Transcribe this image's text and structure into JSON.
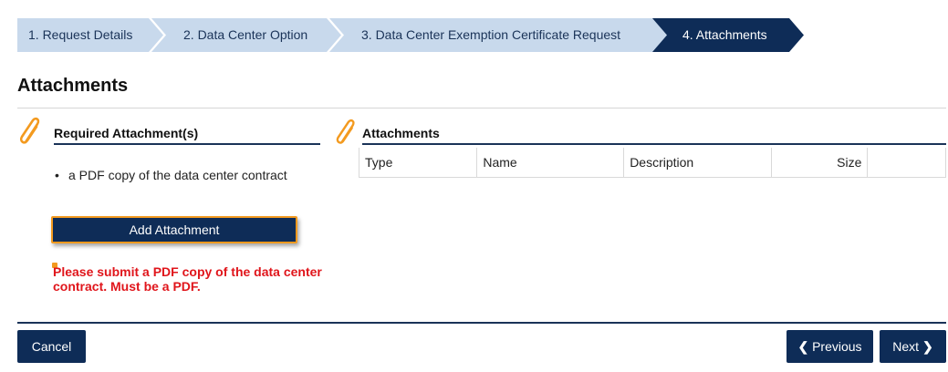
{
  "wizard": {
    "steps": [
      {
        "label": "1. Request Details",
        "active": false
      },
      {
        "label": "2. Data Center Option",
        "active": false
      },
      {
        "label": "3. Data Center Exemption Certificate Request",
        "active": false
      },
      {
        "label": "4. Attachments",
        "active": true
      }
    ],
    "colors": {
      "inactive": "#c8d9ec",
      "active": "#0e2c57"
    }
  },
  "page": {
    "title": "Attachments"
  },
  "required": {
    "heading": "Required Attachment(s)",
    "items": [
      "a PDF copy of the data center contract"
    ],
    "add_button": "Add Attachment",
    "error": "Please submit a PDF copy of the data center contract. Must be a PDF."
  },
  "attachments": {
    "heading": "Attachments",
    "columns": {
      "type": "Type",
      "name": "Name",
      "description": "Description",
      "size": "Size"
    }
  },
  "footer": {
    "cancel": "Cancel",
    "previous": "Previous",
    "next": "Next"
  },
  "icons": {
    "attachment": "paperclip-icon",
    "previous": "chevron-left-icon",
    "next": "chevron-right-icon"
  },
  "colors": {
    "brand": "#0e2c57",
    "accent": "#f39a1f",
    "error": "#e0151b"
  }
}
